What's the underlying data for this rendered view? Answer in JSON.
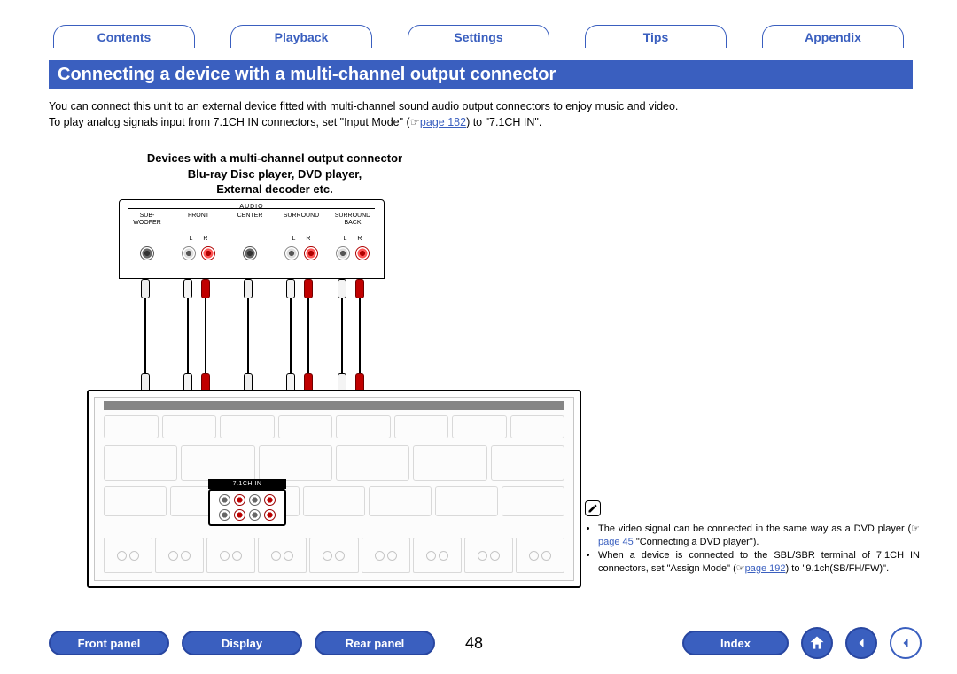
{
  "topnav": {
    "contents": "Contents",
    "playback": "Playback",
    "settings": "Settings",
    "tips": "Tips",
    "appendix": "Appendix"
  },
  "title": "Connecting a device with a multi-channel output connector",
  "intro": {
    "p1": "You can connect this unit to an external device fitted with multi-channel sound audio output connectors to enjoy music and video.",
    "p2a": "To play analog signals input from 7.1CH IN connectors, set \"Input Mode\" (",
    "p2link": "page 182",
    "p2b": ") to \"7.1CH IN\"."
  },
  "device_heading": {
    "l1": "Devices with a multi-channel output connector",
    "l2": "Blu-ray Disc player, DVD player,",
    "l3": "External decoder etc."
  },
  "src_panel": {
    "audio": "AUDIO",
    "cols": [
      "SUB-\nWOOFER",
      "FRONT",
      "CENTER",
      "SURROUND",
      "SURROUND\nBACK"
    ],
    "lr": [
      "L",
      "R"
    ]
  },
  "receiver": {
    "highlight_label": "7.1CH IN"
  },
  "notes": {
    "b1a": "The video signal can be connected in the same way as a DVD player (",
    "b1link": "page 45",
    "b1b": " \"Connecting a DVD player\").",
    "b2a": "When a device is connected to the SBL/SBR terminal of 7.1CH IN connectors, set \"Assign Mode\" (",
    "b2link": "page 192",
    "b2b": ") to \"9.1ch(SB/FH/FW)\"."
  },
  "botnav": {
    "front_panel": "Front panel",
    "display": "Display",
    "rear_panel": "Rear panel",
    "index": "Index"
  },
  "page_number": "48",
  "icons": {
    "pencil": "pencil",
    "home": "home",
    "back": "back",
    "forward": "forward",
    "ref": "☞"
  }
}
